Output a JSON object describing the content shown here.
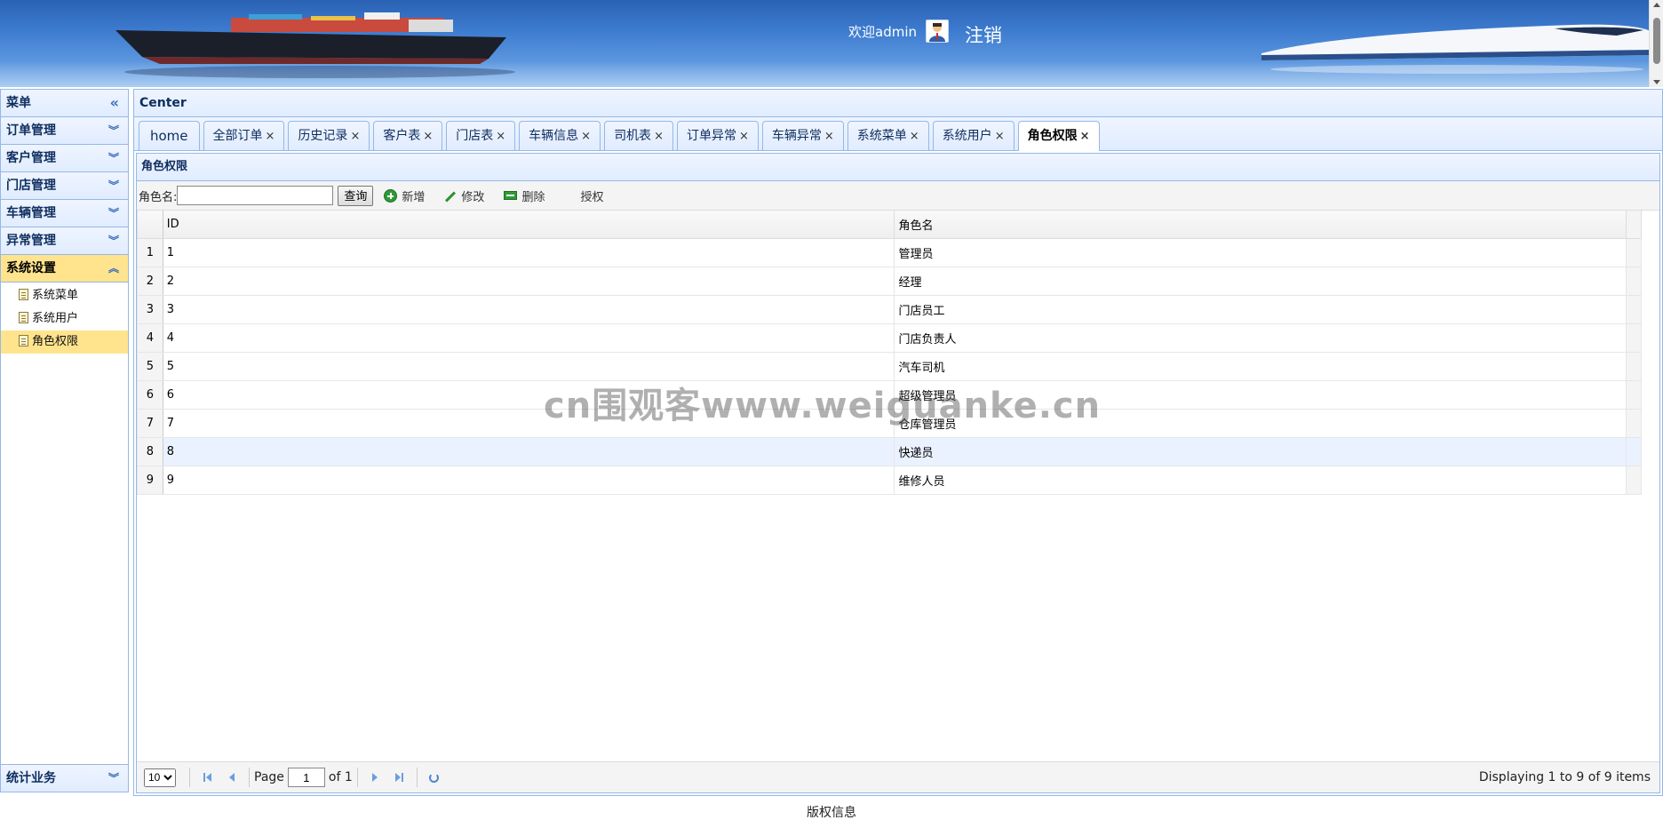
{
  "header": {
    "welcome": "欢迎admin",
    "logout": "注销",
    "colors": {
      "banner_top": "#2a62b4",
      "banner_bottom": "#7fb2ea"
    }
  },
  "sidebar": {
    "title": "菜单",
    "collapse_icon": "double-chevron-left-icon",
    "sections": [
      {
        "label": "订单管理",
        "expanded": false
      },
      {
        "label": "客户管理",
        "expanded": false
      },
      {
        "label": "门店管理",
        "expanded": false
      },
      {
        "label": "车辆管理",
        "expanded": false
      },
      {
        "label": "异常管理",
        "expanded": false
      },
      {
        "label": "系统设置",
        "expanded": true,
        "items": [
          {
            "label": "系统菜单"
          },
          {
            "label": "系统用户"
          },
          {
            "label": "角色权限",
            "selected": true
          }
        ]
      }
    ],
    "bottom_section": "统计业务"
  },
  "center": {
    "title": "Center",
    "tabs": [
      {
        "label": "home"
      },
      {
        "label": "全部订单"
      },
      {
        "label": "历史记录"
      },
      {
        "label": "客户表"
      },
      {
        "label": "门店表"
      },
      {
        "label": "车辆信息"
      },
      {
        "label": "司机表"
      },
      {
        "label": "订单异常"
      },
      {
        "label": "车辆异常"
      },
      {
        "label": "系统菜单"
      },
      {
        "label": "系统用户"
      },
      {
        "label": "角色权限",
        "active": true
      }
    ],
    "close_glyph": "×"
  },
  "panel": {
    "title": "角色权限",
    "toolbar": {
      "search_label": "角色名:",
      "search_value": "",
      "query_button": "查询",
      "add_button": "新增",
      "edit_button": "修改",
      "delete_button": "删除",
      "grant_button": "授权"
    },
    "table": {
      "columns": [
        "ID",
        "角色名"
      ],
      "rows": [
        {
          "rn": "1",
          "id": "1",
          "name": "管理员"
        },
        {
          "rn": "2",
          "id": "2",
          "name": "经理"
        },
        {
          "rn": "3",
          "id": "3",
          "name": "门店员工"
        },
        {
          "rn": "4",
          "id": "4",
          "name": "门店负责人"
        },
        {
          "rn": "5",
          "id": "5",
          "name": "汽车司机"
        },
        {
          "rn": "6",
          "id": "6",
          "name": "超级管理员"
        },
        {
          "rn": "7",
          "id": "7",
          "name": "仓库管理员"
        },
        {
          "rn": "8",
          "id": "8",
          "name": "快递员",
          "highlighted": true
        },
        {
          "rn": "9",
          "id": "9",
          "name": "维修人员"
        }
      ]
    },
    "pager": {
      "page_size": "10",
      "page_label": "Page",
      "page_value": "1",
      "of_label": "of 1",
      "info": "Displaying 1 to 9 of 9 items"
    }
  },
  "footer": {
    "text": "版权信息"
  },
  "watermark": "cn围观客www.weiguanke.cn"
}
